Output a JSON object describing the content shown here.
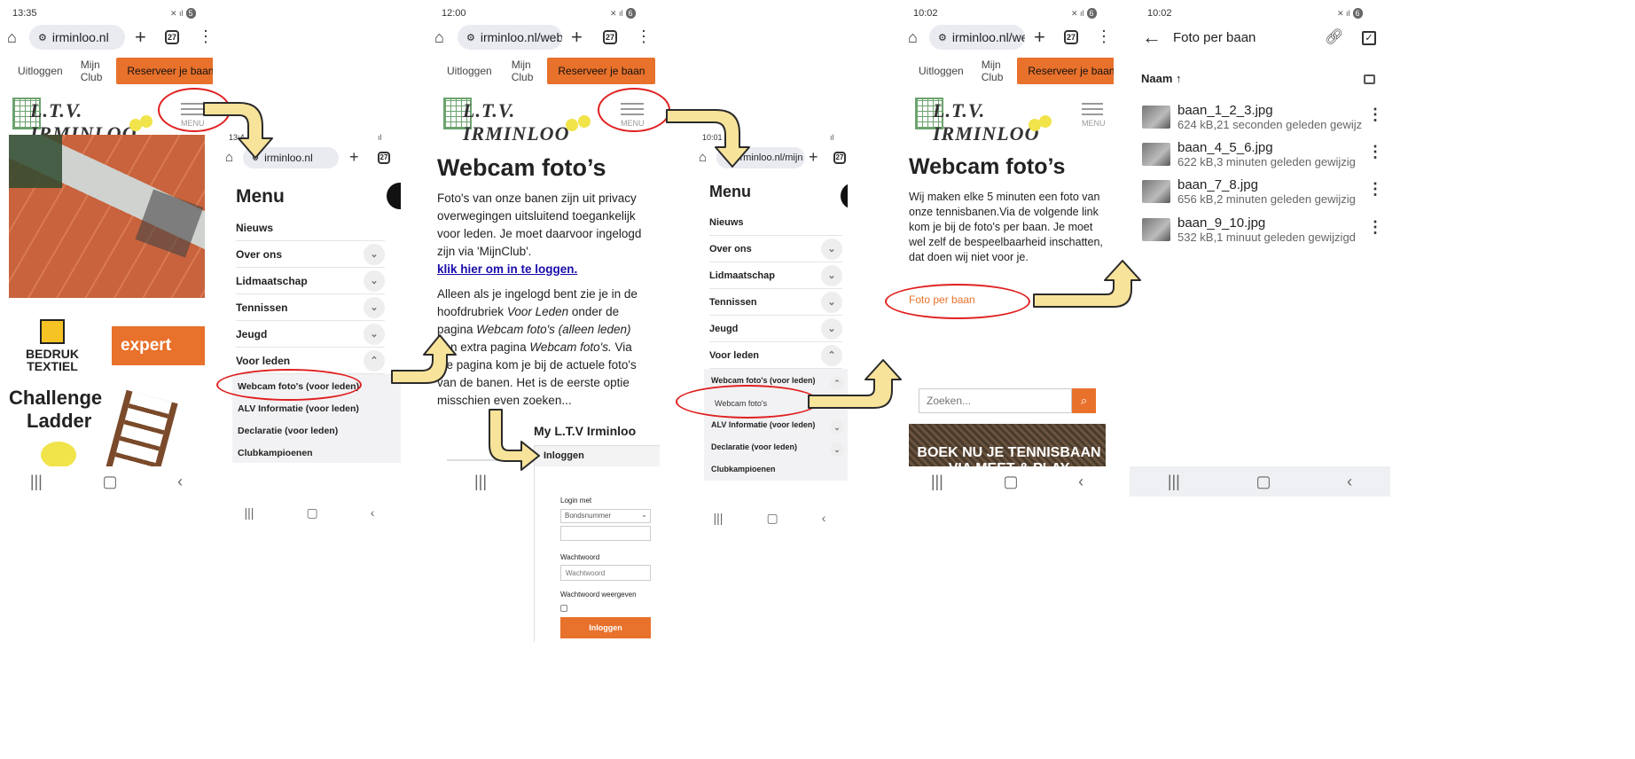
{
  "panel1": {
    "time": "13:35",
    "battery": "5",
    "url": "irminloo.nl",
    "tabs": "27",
    "nav": [
      "Uitloggen",
      "Mijn Club"
    ],
    "cta": "Reserveer je baan",
    "logo": "L.T.V. IRMINLOO",
    "menu": "MENU",
    "sponsor1": "BEDRUK TEXTIEL",
    "sponsor2": "expert",
    "challenge": [
      "Challenge",
      "Ladder"
    ]
  },
  "panel2": {
    "time": "13:4",
    "url": "irminloo.nl",
    "tabs": "27",
    "menu_title": "Menu",
    "items": [
      "Nieuws",
      "Over ons",
      "Lidmaatschap",
      "Tennissen",
      "Jeugd",
      "Voor leden"
    ],
    "subitems": [
      "Webcam foto's (voor leden)",
      "ALV Informatie (voor leden)",
      "Declaratie (voor leden)",
      "Clubkampioenen"
    ]
  },
  "panel3": {
    "time": "12:00",
    "battery": "6",
    "url": "irminloo.nl/webca",
    "tabs": "27",
    "nav": [
      "Uitloggen",
      "Mijn Club"
    ],
    "cta": "Reserveer je baan",
    "logo": "L.T.V. IRMINLOO",
    "menu": "MENU",
    "title": "Webcam foto’s",
    "p1": "Foto's van onze banen zijn uit privacy overwegingen uitsluitend toegankelijk voor leden.  Je moet daarvoor ingelogd zijn via 'MijnClub'.",
    "login_link": "klik hier om in te loggen.",
    "p2a": "Alleen als je ingelogd bent zie je in de hoofdrubriek ",
    "p2b": "Voor Leden",
    "p2c": " onder de pagina ",
    "p2d": "Webcam foto's (alleen leden)",
    "p2e": " een extra pagina ",
    "p2f": "Webcam foto's.",
    "p2g": " Via die pagina kom je bij de actuele foto's van de banen. Het is de eerste optie misschien even zoeken..."
  },
  "login": {
    "title": "My L.T.V Irminloo",
    "tab": "Inloggen",
    "login_with": "Login met",
    "select_value": "Bondsnummer",
    "password_label": "Wachtwoord",
    "password_placeholder": "Wachtwoord",
    "show_password": "Wachtwoord weergeven",
    "button": "Inloggen"
  },
  "panel4": {
    "time": "10:01",
    "url": "irminloo.nl/mijn",
    "tabs": "27",
    "menu_title": "Menu",
    "items": [
      "Nieuws",
      "Over ons",
      "Lidmaatschap",
      "Tennissen",
      "Jeugd",
      "Voor leden"
    ],
    "sub_expanded": "Webcam foto's (voor leden)",
    "sub_sub": "Webcam foto's",
    "subitems": [
      "ALV Informatie (voor leden)",
      "Declaratie (voor leden)",
      "Clubkampioenen"
    ]
  },
  "panel5": {
    "time": "10:02",
    "battery": "6",
    "url": "irminloo.nl/webca",
    "tabs": "27",
    "nav": [
      "Uitloggen",
      "Mijn Club"
    ],
    "cta": "Reserveer je baan",
    "logo": "L.T.V. IRMINLOO",
    "menu": "MENU",
    "title": "Webcam foto’s",
    "p1": "Wij maken elke 5 minuten een foto van onze tennisbanen.Via de volgende link kom je bij de foto's per baan. Je moet wel zelf de bespeelbaarheid inschatten, dat doen wij niet voor je.",
    "link": "Foto per baan",
    "search_placeholder": "Zoeken...",
    "banner": "BOEK NU JE TENNISBAAN VIA MEET & PLAY"
  },
  "panel6": {
    "time": "10:02",
    "battery": "6",
    "title": "Foto per baan",
    "sort_label": "Naam",
    "files": [
      {
        "name": "baan_1_2_3.jpg",
        "meta": "624 kB,21 seconden geleden gewijz"
      },
      {
        "name": "baan_4_5_6.jpg",
        "meta": "622 kB,3 minuten geleden gewijzig"
      },
      {
        "name": "baan_7_8.jpg",
        "meta": "656 kB,2 minuten geleden gewijzig"
      },
      {
        "name": "baan_9_10.jpg",
        "meta": "532 kB,1 minuut geleden gewijzigd"
      }
    ]
  },
  "colors": {
    "accent": "#e8712b",
    "highlight_circle": "#e02020",
    "arrow_fill": "#f8e39a",
    "link_blue": "#1a0dab"
  },
  "icons": [
    "home-icon",
    "plus-icon",
    "more-icon",
    "back-icon",
    "link-icon",
    "select-icon",
    "layout-icon",
    "search-icon",
    "recent-apps-icon",
    "home-nav-icon",
    "back-nav-icon"
  ]
}
